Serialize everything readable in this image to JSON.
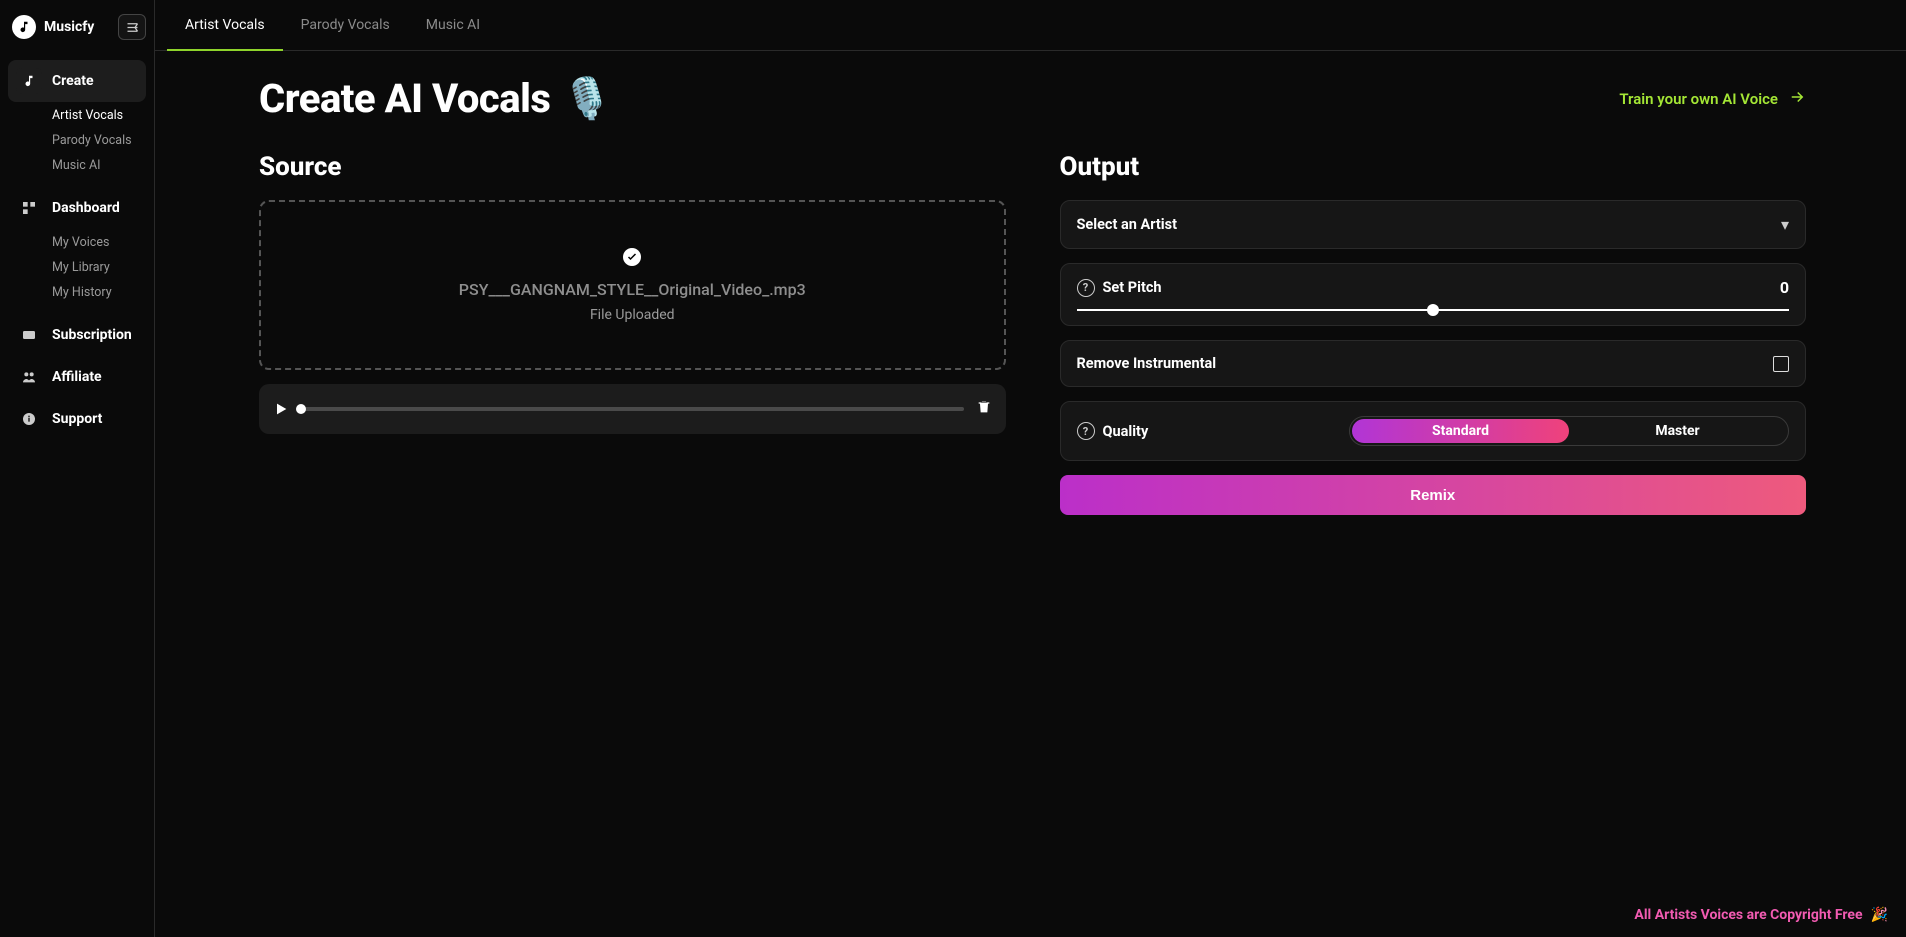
{
  "brand": "Musicfy",
  "sidebar": {
    "create": {
      "label": "Create",
      "items": [
        "Artist Vocals",
        "Parody Vocals",
        "Music AI"
      ],
      "active_index": 0
    },
    "dashboard": {
      "label": "Dashboard",
      "items": [
        "My Voices",
        "My Library",
        "My History"
      ]
    },
    "links": {
      "subscription": "Subscription",
      "affiliate": "Affiliate",
      "support": "Support"
    }
  },
  "tabs": {
    "items": [
      "Artist Vocals",
      "Parody Vocals",
      "Music AI"
    ],
    "active_index": 0
  },
  "hero": {
    "title": "Create AI Vocals",
    "emoji": "🎙️",
    "train_link": "Train your own AI Voice"
  },
  "source": {
    "heading": "Source",
    "file_name": "PSY___GANGNAM_STYLE__Original_Video_.mp3",
    "status": "File Uploaded"
  },
  "output": {
    "heading": "Output",
    "artist_select": {
      "placeholder": "Select an Artist"
    },
    "pitch": {
      "label": "Set Pitch",
      "value": "0"
    },
    "remove_instrumental": {
      "label": "Remove Instrumental",
      "checked": false
    },
    "quality": {
      "label": "Quality",
      "options": [
        "Standard",
        "Master"
      ],
      "active_index": 0
    },
    "remix_button": "Remix"
  },
  "footer": {
    "copyright_note": "All Artists Voices are Copyright Free",
    "emoji": "🎉"
  }
}
